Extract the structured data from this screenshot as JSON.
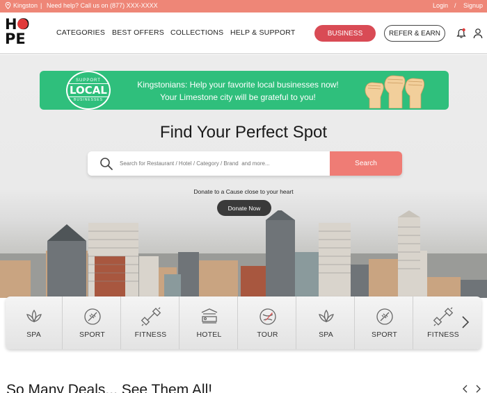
{
  "topbar": {
    "location": "Kingston",
    "separator": "|",
    "help": "Need help? Call us on (877) XXX-XXXX",
    "login": "Login",
    "slash": "/",
    "signup": "Signup"
  },
  "logo": {
    "row1": "HO",
    "row2": "PE"
  },
  "nav": [
    "CATEGORIES",
    "BEST OFFERS",
    "COLLECTIONS",
    "HELP & SUPPORT"
  ],
  "header_buttons": {
    "business": "BUSINESS",
    "refer": "REFER & EARN"
  },
  "banner": {
    "stamp_top": "SUPPORT",
    "stamp_main": "LOCAL",
    "stamp_bottom": "BUSINESSES",
    "line1": "Kingstonians: Help your favorite local businesses now!",
    "line2": "Your Limestone city will be grateful to you!"
  },
  "hero": {
    "title": "Find Your Perfect Spot",
    "search_placeholder": "Search for Restaurant / Hotel / Category / Brand  and more...",
    "search_button": "Search",
    "donate_text": "Donate to a Cause close to your heart",
    "donate_button": "Donate Now"
  },
  "categories": [
    {
      "label": "SPA",
      "icon": "lotus-icon"
    },
    {
      "label": "SPORT",
      "icon": "football-icon"
    },
    {
      "label": "FITNESS",
      "icon": "dumbbell-icon"
    },
    {
      "label": "HOTEL",
      "icon": "hotel-bed-icon"
    },
    {
      "label": "TOUR",
      "icon": "globe-plane-icon"
    },
    {
      "label": "SPA",
      "icon": "lotus-icon"
    },
    {
      "label": "SPORT",
      "icon": "football-icon"
    },
    {
      "label": "FITNESS",
      "icon": "dumbbell-icon"
    }
  ],
  "deals_title": "So Many Deals... See Them All!",
  "colors": {
    "topbar": "#ee8677",
    "business_button": "#d94b55",
    "banner": "#2fbf7c",
    "search_button": "#ef7c75",
    "donate_button": "#3a3a3a"
  }
}
